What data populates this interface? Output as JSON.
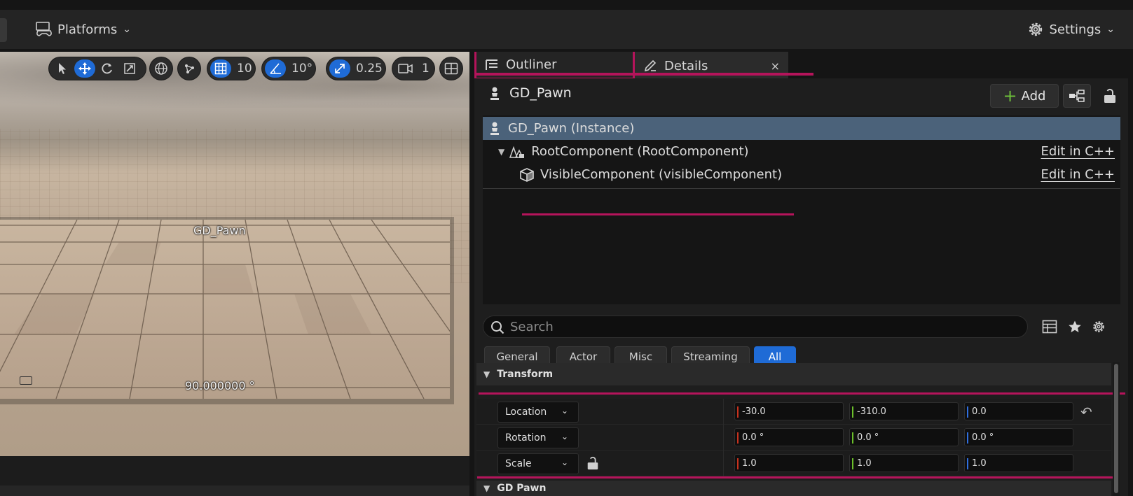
{
  "toolbar": {
    "platforms_label": "Platforms",
    "settings_label": "Settings"
  },
  "viewport": {
    "grid_snap_value": "10",
    "rotation_snap_value": "10°",
    "scale_snap_value": "0.25",
    "camera_speed_value": "1",
    "actor_label": "GD_Pawn",
    "angle_readout": "90.000000 °"
  },
  "tabs": {
    "outliner": "Outliner",
    "details": "Details",
    "close": "×"
  },
  "details": {
    "actor_name": "GD_Pawn",
    "add_label": "Add",
    "components": [
      {
        "label": "GD_Pawn (Instance)",
        "edit": ""
      },
      {
        "label": "RootComponent (RootComponent)",
        "edit": "Edit in C++"
      },
      {
        "label": "VisibleComponent (visibleComponent)",
        "edit": "Edit in C++"
      }
    ],
    "search_placeholder": "Search",
    "filters": [
      "General",
      "Actor",
      "Misc",
      "Streaming",
      "All"
    ],
    "active_filter": "All",
    "categories": {
      "transform": "Transform",
      "gd_pawn": "GD Pawn"
    },
    "transform": {
      "location": {
        "label": "Location",
        "x": "-30.0",
        "y": "-310.0",
        "z": "0.0"
      },
      "rotation": {
        "label": "Rotation",
        "x": "0.0 °",
        "y": "0.0 °",
        "z": "0.0 °"
      },
      "scale": {
        "label": "Scale",
        "x": "1.0",
        "y": "1.0",
        "z": "1.0"
      }
    }
  },
  "colors": {
    "accent_blue": "#1f6bd6",
    "highlight_magenta": "#b5145b",
    "selection": "#4b627a",
    "axis_x": "#c8321e",
    "axis_y": "#6bbf2a",
    "axis_z": "#2f6fe0"
  }
}
